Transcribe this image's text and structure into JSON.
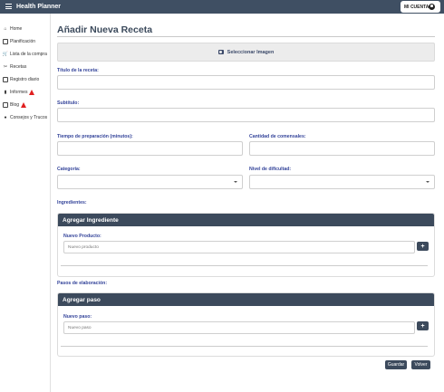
{
  "header": {
    "app_title": "Health Planner",
    "account_label": "MI CUENTA"
  },
  "sidebar": {
    "items": [
      {
        "label": "Home",
        "icon": "home-icon"
      },
      {
        "label": "Planificación",
        "icon": "calendar-icon"
      },
      {
        "label": "Lista de la compra",
        "icon": "shopping-basket-icon"
      },
      {
        "label": "Recetas",
        "icon": "utensils-icon"
      },
      {
        "label": "Registro diario",
        "icon": "notebook-icon"
      },
      {
        "label": "Informes",
        "icon": "bar-chart-icon",
        "warning": true
      },
      {
        "label": "Blog",
        "icon": "book-icon",
        "warning": true
      },
      {
        "label": "Consejos y Trucos",
        "icon": "lightbulb-icon"
      }
    ],
    "warning_color": "#e02020"
  },
  "main": {
    "page_title": "Añadir Nueva Receta",
    "select_image_label": "Seleccionar Imagen",
    "fields": {
      "title_label": "Título de la receta:",
      "subtitle_label": "Subtítulo:",
      "prep_time_label": "Tiempo de preparación (minutos):",
      "servings_label": "Cantidad de comensales:",
      "category_label": "Categoría:",
      "difficulty_label": "Nivel de dificultad:"
    },
    "ingredients": {
      "section_label": "Ingredientes:",
      "card_title": "Agregar Ingrediente",
      "new_label": "Nuevo Producto:",
      "placeholder": "Nuevo producto",
      "add_button": "+"
    },
    "steps": {
      "section_label": "Pasos de elaboración:",
      "card_title": "Agregar paso",
      "new_label": "Nuevo paso:",
      "placeholder": "Nuevo paso",
      "add_button": "+"
    },
    "actions": {
      "save_label": "Guardar",
      "back_label": "Volver"
    }
  },
  "colors": {
    "topbar": "#3f4f63",
    "accent_label": "#34449a",
    "button": "#3c4a5c"
  }
}
